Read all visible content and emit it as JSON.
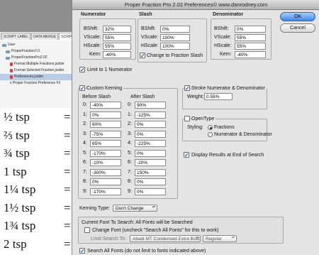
{
  "bg": {
    "tabs": [
      "SCRIPT LABEL",
      "DATA MERGE",
      "SCRIPTS"
    ],
    "tree": [
      "User",
      "ProperFraction2.0",
      "ProperFractionPro2.02",
      "Format Multiple Fractions.jsxbin",
      "Format Selected Fraction.jsxbin",
      "Preferences.jsxbin",
      "x Proper Fraction Preference Fil"
    ],
    "fractions": [
      "½ tsp",
      "⅔ tsp",
      "¾ tsp",
      "1 tsp",
      "1¼ tsp",
      "1½ tsp",
      "1¾ tsp",
      "2 tsp"
    ],
    "equals": "="
  },
  "dialog": {
    "title": "Proper Fraction Pro 2.02 Preferences© www.danrodney.com",
    "ok": "OK",
    "cancel": "Cancel",
    "numerator": {
      "heading": "Numerator",
      "bshift_label": "BShift:",
      "bshift": "32%",
      "vscale_label": "VScale:",
      "vscale": "55%",
      "hscale_label": "HScale:",
      "hscale": "55%",
      "kern_label": "Kern:",
      "kern": "-40%"
    },
    "slash": {
      "heading": "Slash",
      "bshift_label": "BShift:",
      "bshift": "0%",
      "vscale_label": "VScale:",
      "vscale": "100%",
      "hscale_label": "HScale:",
      "hscale": "100%",
      "change_label": "Change to Fraction Slash"
    },
    "denominator": {
      "heading": "Denominator",
      "bshift_label": "BShift:",
      "bshift": "0%",
      "vscale_label": "VScale:",
      "vscale": "55%",
      "hscale_label": "HScale:",
      "hscale": "55%",
      "kern_label": "Kern:",
      "kern": "-40%"
    },
    "limit_label": "Limit to 1 Numerator",
    "custom_kerning": {
      "label": "Custom Kerning",
      "before_heading": "Before Slash",
      "after_heading": "After Slash",
      "rows": [
        {
          "digit": "0:",
          "before": "-40%",
          "after": "90%"
        },
        {
          "digit": "1:",
          "before": "0%",
          "after": "-125%"
        },
        {
          "digit": "2:",
          "before": "60%",
          "after": "0%"
        },
        {
          "digit": "3:",
          "before": "-75%",
          "after": "0%"
        },
        {
          "digit": "4:",
          "before": "65%",
          "after": "-225%"
        },
        {
          "digit": "5:",
          "before": "-170%",
          "after": "0%"
        },
        {
          "digit": "6:",
          "before": "-10%",
          "after": "-20%"
        },
        {
          "digit": "7:",
          "before": "-300%",
          "after": "150%"
        },
        {
          "digit": "8:",
          "before": "0%",
          "after": "0%"
        },
        {
          "digit": "9:",
          "before": "-170%",
          "after": "0%"
        }
      ]
    },
    "stroke": {
      "label": "Stroke Numerator & Denominator",
      "weight_label": "Weight:",
      "weight": "0.55%"
    },
    "opentype": {
      "label": "OpenType",
      "styling_label": "Styling:",
      "opt1": "Fractions",
      "opt2": "Numerator & Denominator"
    },
    "display_label": "Display Results at End of Search",
    "kerning_type_label": "Kerning Type:",
    "kerning_type_value": "Don't Change",
    "current_font": {
      "text": "Current Font To Search:  All Fonts will be Searched",
      "change_font": "Change Font (uncheck \"Search All Fonts\" for this to work)",
      "limit_label": "Limit Search To:",
      "font_value": "Abadi MT Condensed Extra Bold",
      "style_value": "Regular"
    },
    "search_all": "Search All Fonts (do not limit to fonts indicated above)"
  }
}
